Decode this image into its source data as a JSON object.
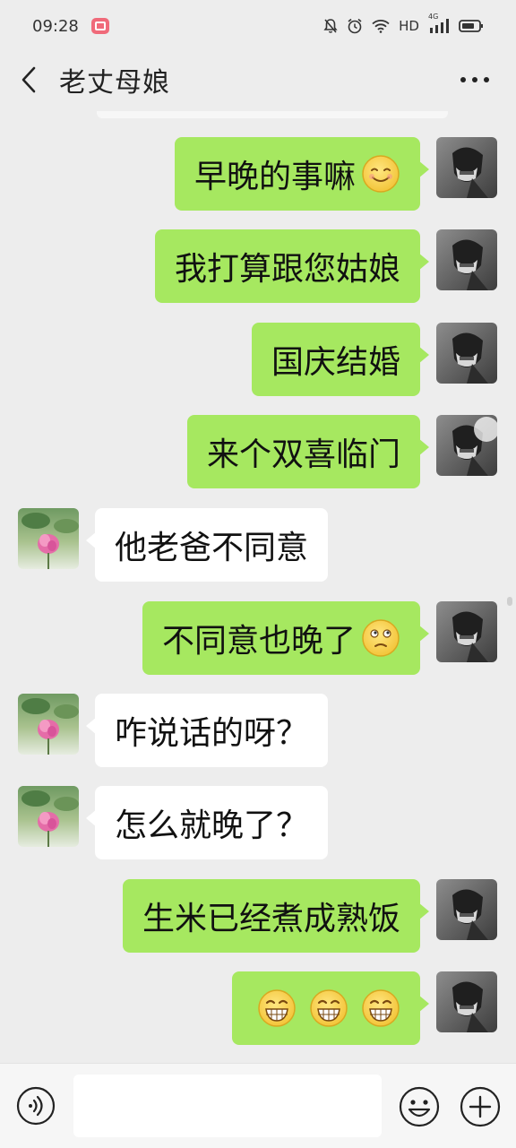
{
  "status_bar": {
    "time": "09:28",
    "network": "HD",
    "signal_label": "4G"
  },
  "header": {
    "title": "老丈母娘",
    "more_label": "···"
  },
  "messages": [
    {
      "sender": "me",
      "text": "早晚的事嘛",
      "emoji": "smile-emoji"
    },
    {
      "sender": "me",
      "text": "我打算跟您姑娘"
    },
    {
      "sender": "me",
      "text": "国庆结婚"
    },
    {
      "sender": "me",
      "text": "来个双喜临门"
    },
    {
      "sender": "other",
      "text": "他老爸不同意"
    },
    {
      "sender": "me",
      "text": "不同意也晚了",
      "emoji": "thinking-emoji"
    },
    {
      "sender": "other",
      "text": "咋说话的呀？"
    },
    {
      "sender": "other",
      "text": "怎么就晚了？"
    },
    {
      "sender": "me",
      "text": "生米已经煮成熟饭"
    },
    {
      "sender": "me",
      "text": "",
      "emoji": "grin-emoji x3"
    }
  ],
  "input_bar": {
    "placeholder": ""
  },
  "colors": {
    "background": "#ededed",
    "my_bubble": "#a6e860",
    "their_bubble": "#ffffff"
  }
}
